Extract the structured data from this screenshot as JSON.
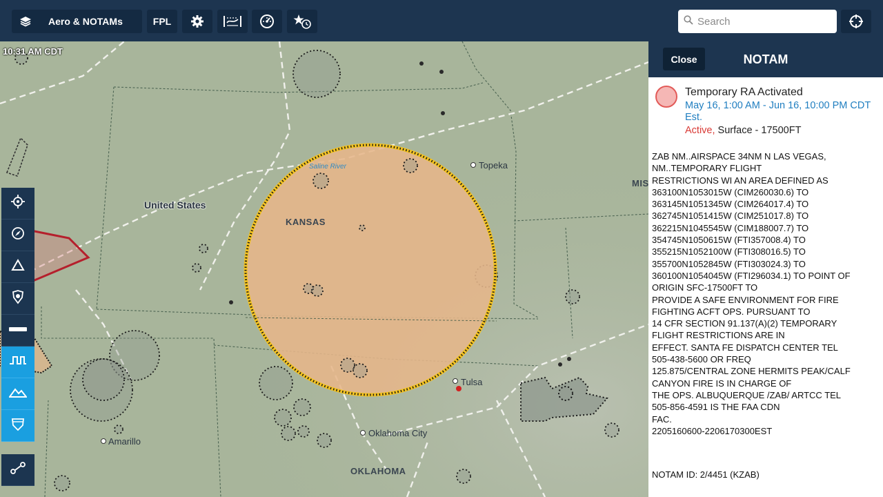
{
  "toolbar": {
    "layers_label": "Aero & NOTAMs",
    "fpl_label": "FPL",
    "search_placeholder": "Search"
  },
  "map": {
    "clock": "10:31 AM CDT",
    "labels": {
      "country": "United States",
      "kansas": "KANSAS",
      "oklahoma": "OKLAHOMA",
      "missouri": "MIS",
      "topeka": "Topeka",
      "tulsa": "Tulsa",
      "okc": "Oklahoma City",
      "amarillo": "Amarillo",
      "saline": "Saline River"
    }
  },
  "panel": {
    "close_label": "Close",
    "title": "NOTAM",
    "notam_title": "Temporary RA Activated",
    "dates": "May 16, 1:00 AM - Jun 16, 10:00 PM CDT Est.",
    "status_active": "Active,",
    "status_altitude": " Surface - 17500FT",
    "body_lines": [
      "ZAB NM..AIRSPACE 34NM N LAS VEGAS,",
      "NM..TEMPORARY FLIGHT",
      "RESTRICTIONS WI AN AREA DEFINED AS",
      "363100N1053015W (CIM260030.6) TO",
      "363145N1051345W (CIM264017.4) TO",
      "362745N1051415W (CIM251017.8) TO",
      "362215N1045545W (CIM188007.7) TO",
      "354745N1050615W (FTI357008.4) TO",
      "355215N1052100W (FTI308016.5) TO",
      "355700N1052845W (FTI303024.3) TO",
      "360100N1054045W (FTI296034.1) TO POINT OF",
      "ORIGIN SFC-17500FT TO",
      "PROVIDE A SAFE ENVIRONMENT FOR FIRE",
      "FIGHTING ACFT OPS. PURSUANT TO",
      "14 CFR SECTION 91.137(A)(2) TEMPORARY",
      "FLIGHT RESTRICTIONS ARE IN",
      "EFFECT. SANTA FE DISPATCH CENTER TEL",
      "505-438-5600 OR FREQ",
      "125.875/CENTRAL ZONE HERMITS PEAK/CALF",
      "CANYON FIRE IS IN CHARGE OF",
      "THE OPS. ALBUQUERQUE /ZAB/ ARTCC TEL",
      "505-856-4591 IS THE FAA CDN",
      "FAC.",
      "2205160600-2206170300EST"
    ],
    "notam_id": "NOTAM ID: 2/4451 (KZAB)"
  },
  "colors": {
    "topbar": "#1d3550",
    "accent_blue": "#1a9fe0",
    "tfr_fill": "#e6b68a",
    "tfr_border": "#f3c21f",
    "active_red": "#d93a36",
    "date_blue": "#1f7ec0"
  }
}
